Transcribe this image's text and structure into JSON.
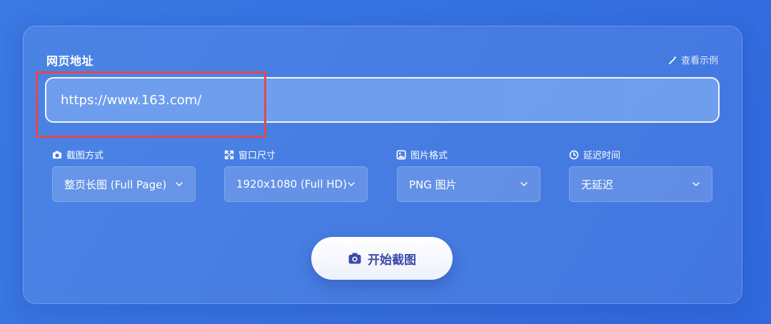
{
  "form": {
    "url_label": "网页地址",
    "example_link": "查看示例",
    "url_value": "https://www.163.com/"
  },
  "options": [
    {
      "label": "截图方式",
      "icon": "camera-icon",
      "value": "整页长图 (Full Page)"
    },
    {
      "label": "窗口尺寸",
      "icon": "expand-icon",
      "value": "1920x1080 (Full HD)"
    },
    {
      "label": "图片格式",
      "icon": "image-icon",
      "value": "PNG 图片"
    },
    {
      "label": "延迟时间",
      "icon": "clock-icon",
      "value": "无延迟"
    }
  ],
  "actions": {
    "start_label": "开始截图"
  },
  "colors": {
    "background": "#3571e0",
    "highlight": "#e5484d",
    "button_text": "#3b4aa8"
  }
}
